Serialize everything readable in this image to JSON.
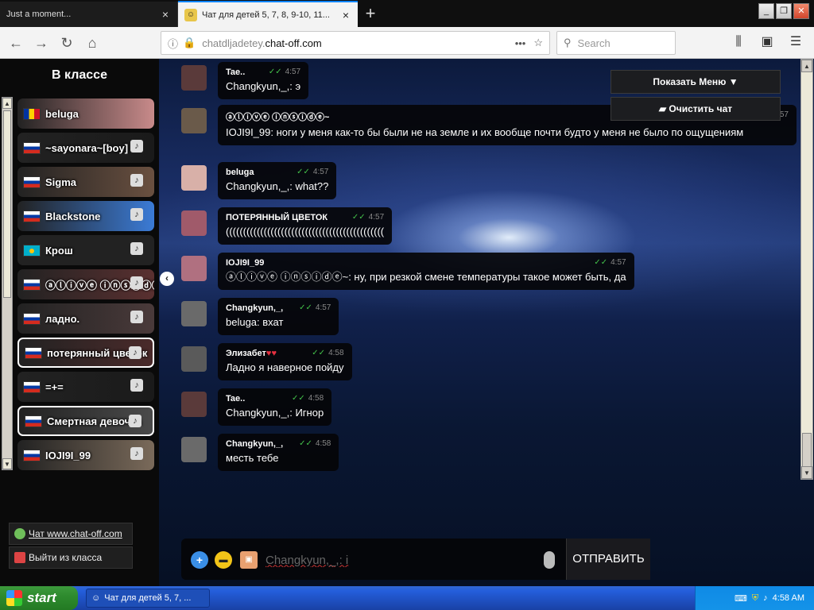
{
  "browser": {
    "tabs": [
      {
        "title": "Just a moment...",
        "active": false
      },
      {
        "title": "Чат для детей 5, 7, 8, 9-10, 11...",
        "active": true
      }
    ],
    "url_host": "chatdljadetey.",
    "url_domain": "chat-off.com",
    "search_placeholder": "Search"
  },
  "sidebar": {
    "title": "В классе",
    "users": [
      {
        "name": "beluga",
        "flag": "ro",
        "bg": "#c88a8a"
      },
      {
        "name": "~sayonara~[boy]",
        "flag": "ru",
        "bg": "#1a1a1a"
      },
      {
        "name": "Sigma",
        "flag": "ru",
        "bg": "#6a5040"
      },
      {
        "name": "Blackstone",
        "flag": "ru",
        "bg": "#3b7bd6"
      },
      {
        "name": "Крош",
        "flag": "kz",
        "bg": "#222222"
      },
      {
        "name": "ⓐⓛⓘⓥⓔ ⓘⓝⓢⓘⓓⓔ",
        "flag": "ru",
        "bg": "#5a3030"
      },
      {
        "name": "ладно.",
        "flag": "ru",
        "bg": "#4a3a3a"
      },
      {
        "name": "потерянный цветок",
        "flag": "ru",
        "bg": "#4a2a2a"
      },
      {
        "name": "=+=",
        "flag": "ru",
        "bg": "#1a1a1a"
      },
      {
        "name": "Смертная девочка",
        "flag": "ru",
        "bg": "#4a4a4a"
      },
      {
        "name": "IOJI9I_99",
        "flag": "ru",
        "bg": "#7a6a5a"
      }
    ],
    "links": [
      {
        "label": "Чат www.chat-off.com"
      },
      {
        "label": "Выйти из класса"
      }
    ]
  },
  "chat": {
    "messages": [
      {
        "author": "Tae..",
        "time": "4:57",
        "text": "Changkyun,_,: э",
        "avatar": "#5a3a3a"
      },
      {
        "author": "ⓐⓛⓘⓥⓔ ⓘⓝⓢⓘⓓⓔ~",
        "time": "4:57",
        "text": "IOJI9I_99: ноги у меня как-то бы были не на земле и их вообще почти будто у меня не было по ощущениям",
        "avatar": "#6a5a4a"
      },
      {
        "author": "beluga",
        "time": "4:57",
        "text": "Changkyun,_,: what??",
        "avatar": "#d8b0a8"
      },
      {
        "author": "ПОТЕРЯННЫЙ ЦВЕТОК",
        "time": "4:57",
        "text": "((((((((((((((((((((((((((((((((((((((((((((((",
        "avatar": "#a05a6a"
      },
      {
        "author": "IOJI9I_99",
        "time": "4:57",
        "text": "ⓐⓛⓘⓥⓔ ⓘⓝⓢⓘⓓⓔ~: ну, при резкой смене температуры такое может быть, да",
        "avatar": "#b07080"
      },
      {
        "author": "Changkyun,_,",
        "time": "4:57",
        "text": "beluga: вхат",
        "avatar": "#6a6a6a"
      },
      {
        "author": "Элизабет",
        "hearts": "♥♥",
        "time": "4:58",
        "text": "Ладно я наверное пойду",
        "avatar": "#5a5a5a"
      },
      {
        "author": "Tae..",
        "time": "4:58",
        "text": "Changkyun,_,: Игнор",
        "avatar": "#5a3a3a"
      },
      {
        "author": "Changkyun,_,",
        "time": "4:58",
        "text": "месть тебе",
        "avatar": "#6a6a6a"
      }
    ],
    "ticks": "✓✓",
    "show_menu_label": "Показать Меню ▼",
    "clear_chat_label": "Очистить чат",
    "input_value": "Changkyun,_,: i",
    "send_label": "ОТПРАВИТЬ"
  },
  "taskbar": {
    "start_label": "start",
    "task_label": "Чат для детей 5, 7, ...",
    "clock": "4:58 AM"
  }
}
